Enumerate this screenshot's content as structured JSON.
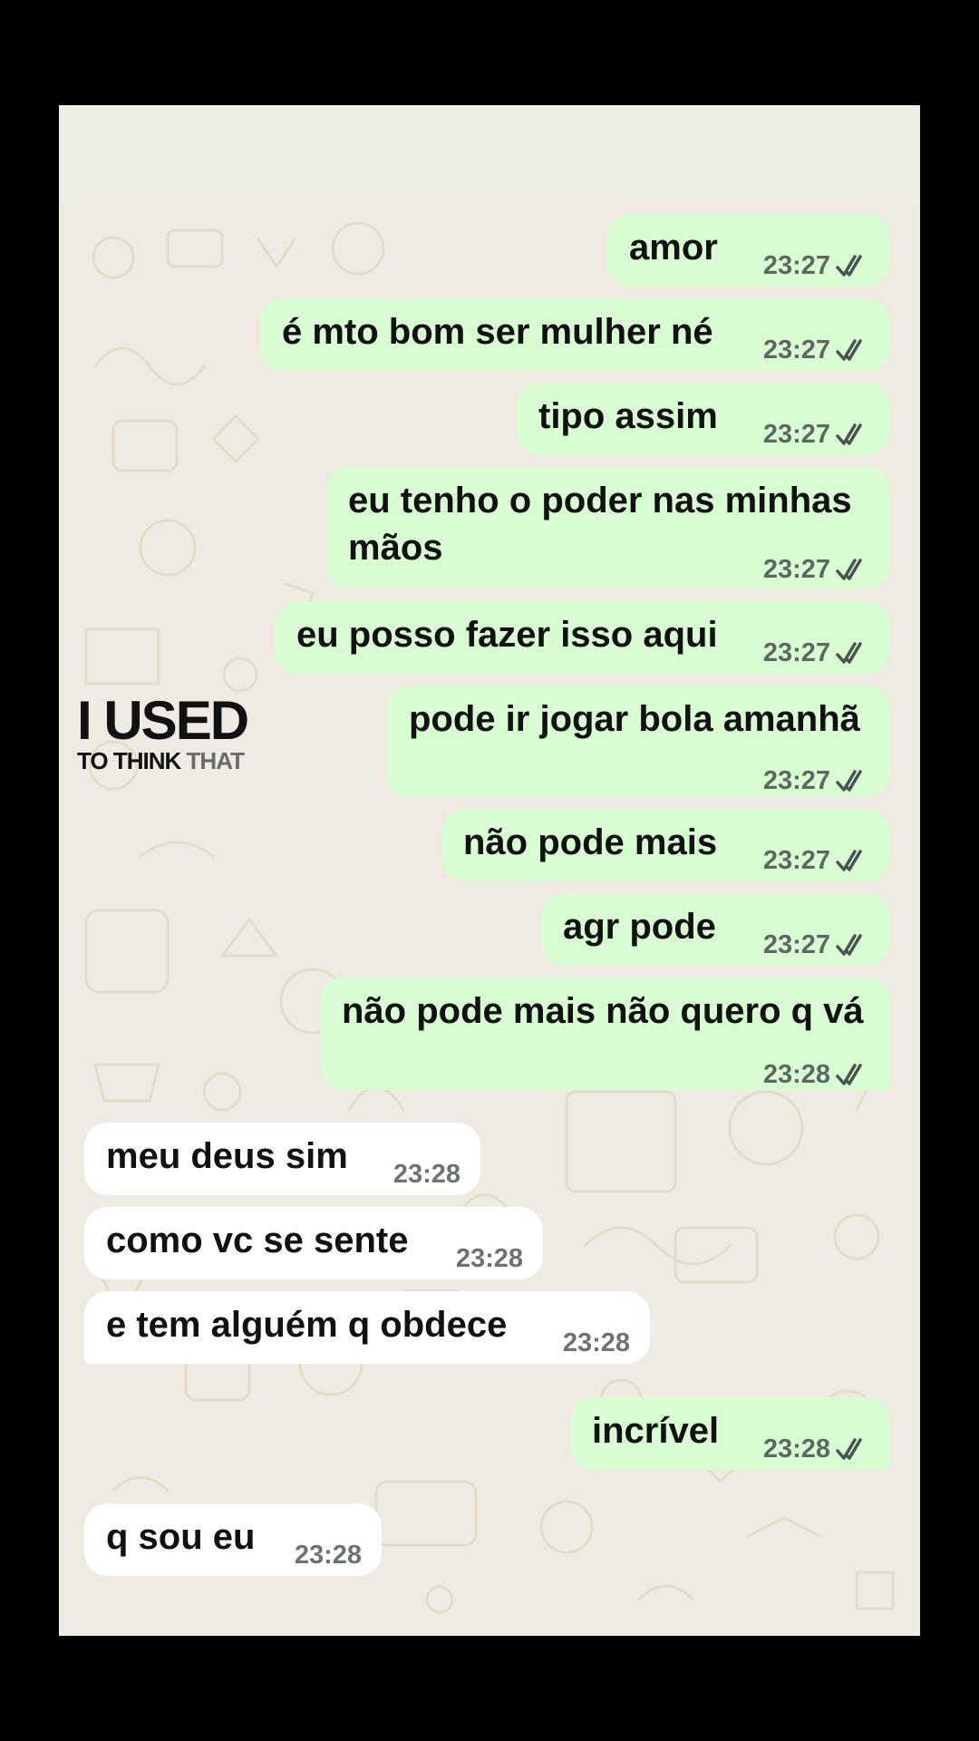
{
  "chat": {
    "messages": [
      {
        "direction": "out",
        "text": "amor",
        "time": "23:27",
        "status": "read"
      },
      {
        "direction": "out",
        "text": "é mto bom ser mulher né",
        "time": "23:27",
        "status": "read"
      },
      {
        "direction": "out",
        "text": "tipo assim",
        "time": "23:27",
        "status": "read"
      },
      {
        "direction": "out",
        "text": "eu tenho o poder nas minhas",
        "text2": "mãos",
        "time": "23:27",
        "status": "read"
      },
      {
        "direction": "out",
        "text": "eu posso fazer isso aqui",
        "time": "23:27",
        "status": "read"
      },
      {
        "direction": "out",
        "text": "pode ir jogar bola amanhã",
        "time": "23:27",
        "status": "read"
      },
      {
        "direction": "out",
        "text": "não pode mais",
        "time": "23:27",
        "status": "read"
      },
      {
        "direction": "out",
        "text": "agr pode",
        "time": "23:27",
        "status": "read"
      },
      {
        "direction": "out",
        "text": "não pode mais não quero q vá",
        "time": "23:28",
        "status": "read"
      },
      {
        "direction": "in",
        "text": "meu deus sim",
        "time": "23:28"
      },
      {
        "direction": "in",
        "text": "como vc se sente",
        "time": "23:28"
      },
      {
        "direction": "in",
        "text": "e tem alguém q obdece",
        "time": "23:28"
      },
      {
        "direction": "out",
        "text": "incrível",
        "time": "23:28",
        "status": "read"
      },
      {
        "direction": "in",
        "text": "q sou eu",
        "time": "23:28"
      }
    ]
  },
  "watermark": {
    "line1": "I USED",
    "line2a": "TO THINK",
    "line2b": "THAT"
  },
  "colors": {
    "outgoing_bubble": "#d9fdd3",
    "incoming_bubble": "#ffffff",
    "wallpaper": "#efeae2",
    "read_ticks": "#4b524f"
  },
  "icons": {
    "read_receipt": "double-check-icon"
  }
}
